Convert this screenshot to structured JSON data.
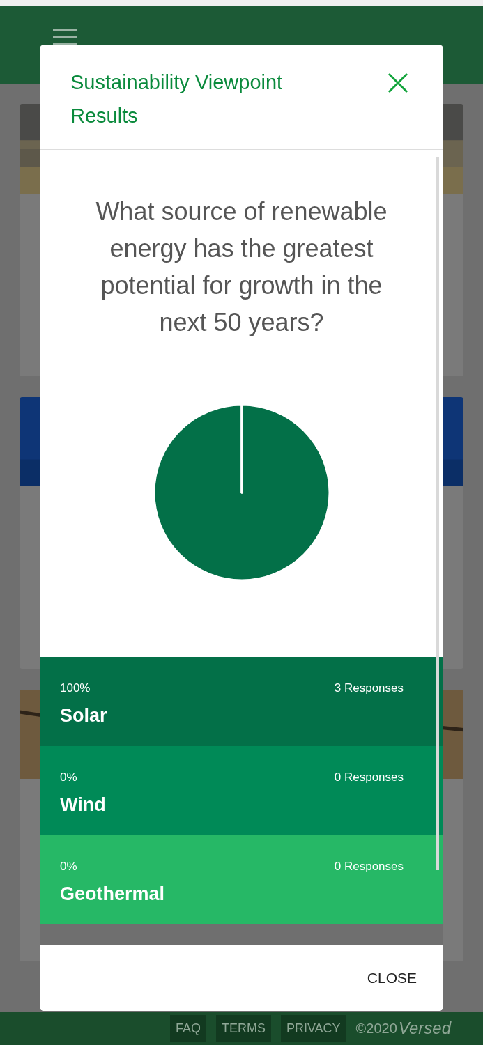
{
  "modal": {
    "title": "Sustainability Viewpoint Results",
    "question": "What source of renewable energy has the greatest potential for growth in the next 50 years?",
    "chart_data": {
      "type": "pie",
      "categories": [
        "Solar",
        "Wind",
        "Geothermal"
      ],
      "values": [
        100,
        0,
        0
      ]
    },
    "options": [
      {
        "percent": "100%",
        "responses": "3 Responses",
        "color": "#037048"
      },
      {
        "percent": "0%",
        "responses": "0 Responses",
        "color": "#008a57"
      },
      {
        "percent": "0%",
        "responses": "0 Responses",
        "color": "#26b866"
      }
    ],
    "close_button": "CLOSE"
  },
  "footer": {
    "links": [
      "FAQ",
      "TERMS",
      "PRIVACY"
    ],
    "copyright": "©2020",
    "brand": "Versed"
  }
}
